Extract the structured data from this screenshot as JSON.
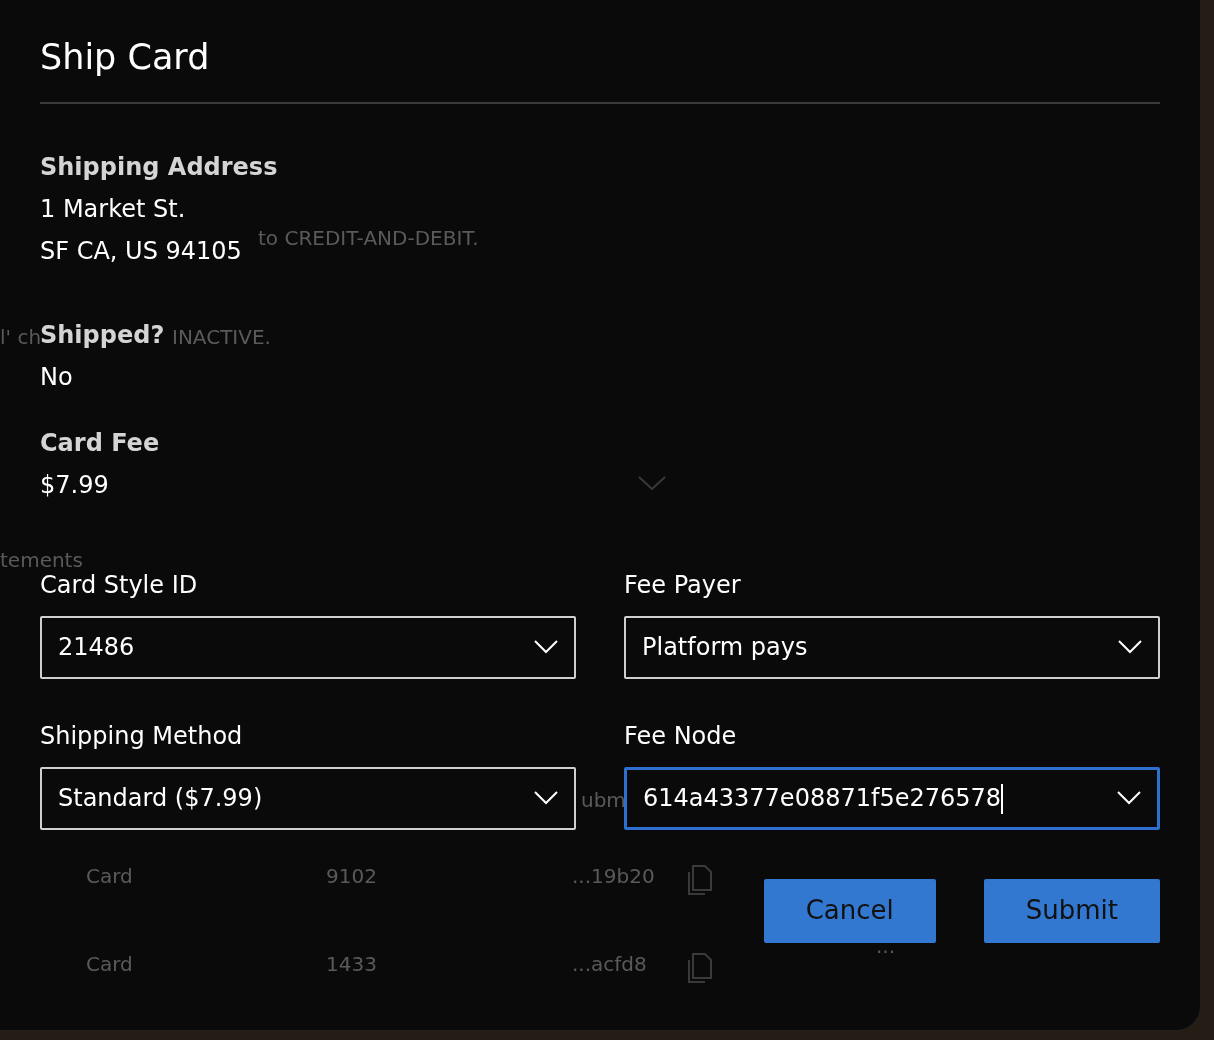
{
  "background": {
    "lines": [
      "to CREDIT-AND-DEBIT.",
      "l' ch",
      "INACTIVE.",
      "tements",
      "ubm"
    ],
    "rows": [
      {
        "type": "Card",
        "number": "9102",
        "id": "...19b20"
      },
      {
        "type": "Card",
        "number": "1433",
        "id": "...acfd8",
        "menu": "···"
      }
    ]
  },
  "dialog": {
    "title": "Ship Card",
    "details": [
      {
        "label": "Shipping Address",
        "values": [
          "1 Market St.",
          "SF CA, US 94105"
        ]
      },
      {
        "label": "Shipped?",
        "values": [
          "No"
        ]
      },
      {
        "label": "Card Fee",
        "values": [
          "$7.99"
        ]
      }
    ],
    "fields": [
      {
        "label": "Card Style ID",
        "value": "21486",
        "focused": false
      },
      {
        "label": "Fee Payer",
        "value": "Platform pays",
        "focused": false
      },
      {
        "label": "Shipping Method",
        "value": "Standard ($7.99)",
        "focused": false
      },
      {
        "label": "Fee Node",
        "value": "614a43377e08871f5e276578",
        "focused": true
      }
    ],
    "buttons": [
      "Cancel",
      "Submit"
    ]
  }
}
